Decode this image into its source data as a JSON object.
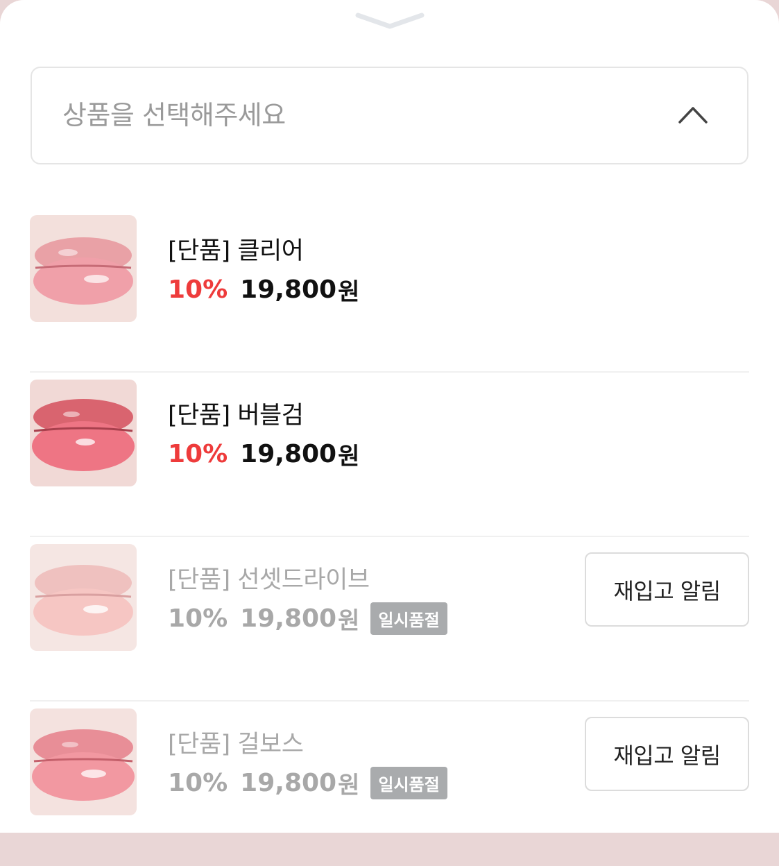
{
  "select": {
    "placeholder": "상품을 선택해주세요",
    "chevron_icon": "chevron-up-icon"
  },
  "colors": {
    "discount": "#ee3b3b",
    "muted": "#a8a8a8",
    "badge_bg": "#a9abad"
  },
  "products": [
    {
      "name": "[단품] 클리어",
      "discount": "10%",
      "price": "19,800",
      "currency": "원",
      "sold_out": false,
      "lip_tone": "#f2a6ad"
    },
    {
      "name": "[단품] 버블검",
      "discount": "10%",
      "price": "19,800",
      "currency": "원",
      "sold_out": false,
      "lip_tone": "#e9707e"
    },
    {
      "name": "[단품] 선셋드라이브",
      "discount": "10%",
      "price": "19,800",
      "currency": "원",
      "sold_out": true,
      "badge": "일시품절",
      "restock_label": "재입고 알림",
      "lip_tone": "#f7c3c0"
    },
    {
      "name": "[단품] 걸보스",
      "discount": "10%",
      "price": "19,800",
      "currency": "원",
      "sold_out": true,
      "badge": "일시품절",
      "restock_label": "재입고 알림",
      "lip_tone": "#f29ca3"
    }
  ]
}
